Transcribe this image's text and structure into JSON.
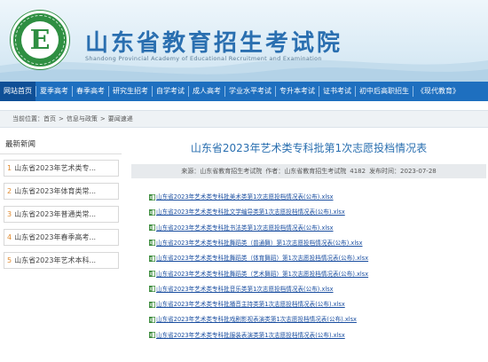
{
  "header": {
    "title": "山东省教育招生考试院",
    "subtitle": "Shandong Provincial Academy of Educational Recruitment and Examination",
    "logo_letter": "E"
  },
  "nav": {
    "items": [
      {
        "label": "网站首页",
        "active": true
      },
      {
        "label": "夏季高考"
      },
      {
        "label": "春季高考"
      },
      {
        "label": "研究生招考"
      },
      {
        "label": "自学考试"
      },
      {
        "label": "成人高考"
      },
      {
        "label": "学业水平考试"
      },
      {
        "label": "专升本考试"
      },
      {
        "label": "证书考试"
      },
      {
        "label": "初中后高职招生"
      },
      {
        "label": "《现代教育》"
      }
    ]
  },
  "breadcrumb": {
    "prefix": "当前位置：",
    "items": [
      "首页",
      "信息与政策",
      "要闻速递"
    ],
    "separator": ">"
  },
  "sidebar": {
    "title": "最新新闻",
    "items": [
      {
        "num": "1",
        "label": "山东省2023年艺术类专..."
      },
      {
        "num": "2",
        "label": "山东省2023年体育类常..."
      },
      {
        "num": "3",
        "label": "山东省2023年普通类常..."
      },
      {
        "num": "4",
        "label": "山东省2023年春季高考..."
      },
      {
        "num": "5",
        "label": "山东省2023年艺术本科..."
      }
    ]
  },
  "article": {
    "title": "山东省2023年艺术类专科批第1次志愿投档情况表",
    "meta": {
      "source": "来源：山东省教育招生考试院",
      "author": "作者：山东省教育招生考试院",
      "views": "4182",
      "published": "发布时间：2023-07-28"
    },
    "files": [
      "山东省2023年艺术类专科批美术类第1次志愿投档情况表(公布).xlsx",
      "山东省2023年艺术类专科批文学编导类第1次志愿投档情况表(公布).xlsx",
      "山东省2023年艺术类专科批书法类第1次志愿投档情况表(公布).xlsx",
      "山东省2023年艺术类专科批舞蹈类（普通舞）第1次志愿投档情况表(公布).xlsx",
      "山东省2023年艺术类专科批舞蹈类（体育舞蹈）第1次志愿投档情况表(公布).xlsx",
      "山东省2023年艺术类专科批舞蹈类（艺术舞蹈）第1次志愿投档情况表(公布).xlsx",
      "山东省2023年艺术类专科批音乐类第1次志愿投档情况表(公布).xlsx",
      "山东省2023年艺术类专科批播音主持类第1次志愿投档情况表(公布).xlsx",
      "山东省2023年艺术类专科批戏剧影视表演类第1次志愿投档情况表(公布).xlsx",
      "山东省2023年艺术类专科批服装表演类第1次志愿投档情况表(公布).xlsx"
    ]
  },
  "colors": {
    "brand_blue": "#2a6fb0",
    "nav_blue": "#1e6fbf",
    "logo_green": "#2f8f42",
    "accent_orange": "#e08a2e"
  }
}
